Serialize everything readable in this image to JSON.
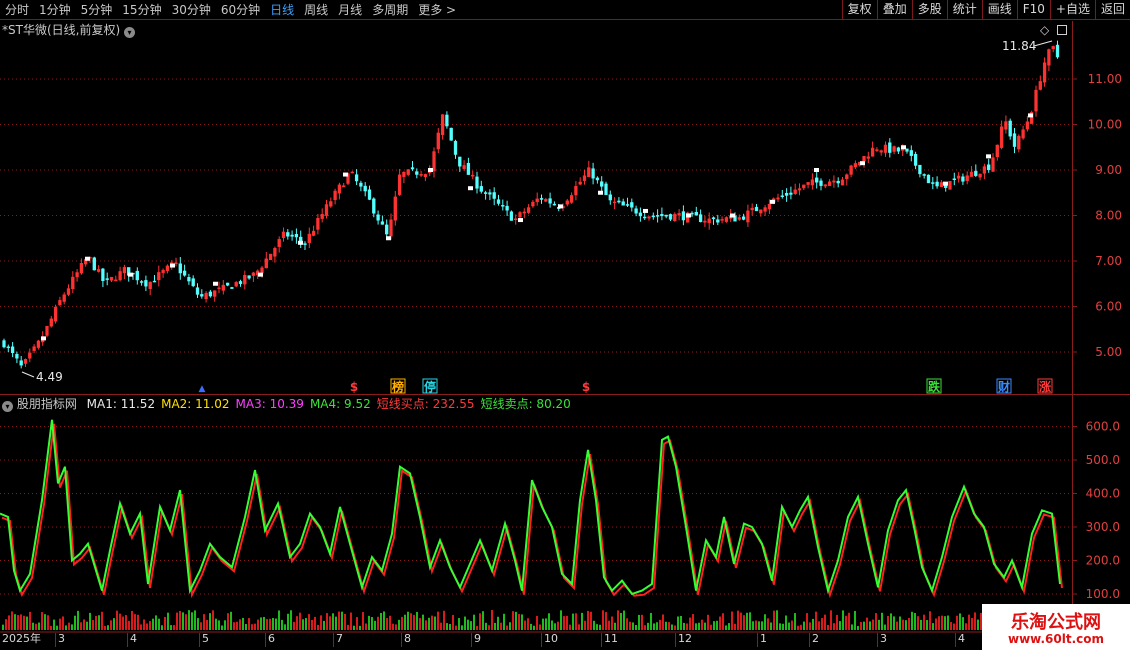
{
  "toolbar": {
    "periods": [
      "分时",
      "1分钟",
      "5分钟",
      "15分钟",
      "30分钟",
      "60分钟",
      "日线",
      "周线",
      "月线",
      "多周期",
      "更多 >"
    ],
    "active_period": "日线",
    "tools": [
      "复权",
      "叠加",
      "多股",
      "统计",
      "画线",
      "F10",
      "+自选",
      "返回"
    ]
  },
  "main_chart": {
    "title": "*ST华微(日线,前复权)",
    "high_label": "11.84",
    "low_label": "4.49",
    "price_axis": [
      "11.00",
      "10.00",
      "9.00",
      "8.00",
      "7.00",
      "6.00",
      "5.00"
    ],
    "markers": [
      {
        "label": "▲",
        "color": "#3a6cff",
        "type": "arrow"
      },
      {
        "label": "$",
        "color": "#ff3a3a",
        "type": "plain"
      },
      {
        "label": "榜",
        "color": "#ffb000",
        "type": "box"
      },
      {
        "label": "停",
        "color": "#27d6e6",
        "type": "box"
      },
      {
        "label": "$",
        "color": "#ff3a3a",
        "type": "plain"
      },
      {
        "label": "跌",
        "color": "#3be13b",
        "type": "box"
      },
      {
        "label": "财",
        "color": "#3a8cff",
        "type": "box"
      },
      {
        "label": "涨",
        "color": "#ff3a3a",
        "type": "box"
      }
    ]
  },
  "indicator": {
    "name": "股朋指标网",
    "items": [
      {
        "label": "MA1: 11.52",
        "color": "#e8e8e8"
      },
      {
        "label": "MA2: 11.02",
        "color": "#ffe000"
      },
      {
        "label": "MA3: 10.39",
        "color": "#ff40ff"
      },
      {
        "label": "MA4: 9.52",
        "color": "#3be13b"
      },
      {
        "label": "短线买点: 232.55",
        "color": "#ff3a3a"
      },
      {
        "label": "短线卖点: 80.20",
        "color": "#3be13b"
      }
    ],
    "axis": [
      "600.0",
      "500.0",
      "400.0",
      "300.0",
      "200.0",
      "100.0"
    ]
  },
  "date_axis": {
    "year_label": "2025年",
    "months": [
      "3",
      "4",
      "5",
      "6",
      "7",
      "8",
      "9",
      "10",
      "11",
      "12",
      "1",
      "2",
      "3",
      "4"
    ]
  },
  "watermark": {
    "title": "乐淘公式网",
    "url": "www.60lt.com"
  },
  "colors": {
    "up": "#ff3232",
    "down": "#54ffff",
    "line": "#33ff33",
    "grid": "#8b1c1c"
  }
}
